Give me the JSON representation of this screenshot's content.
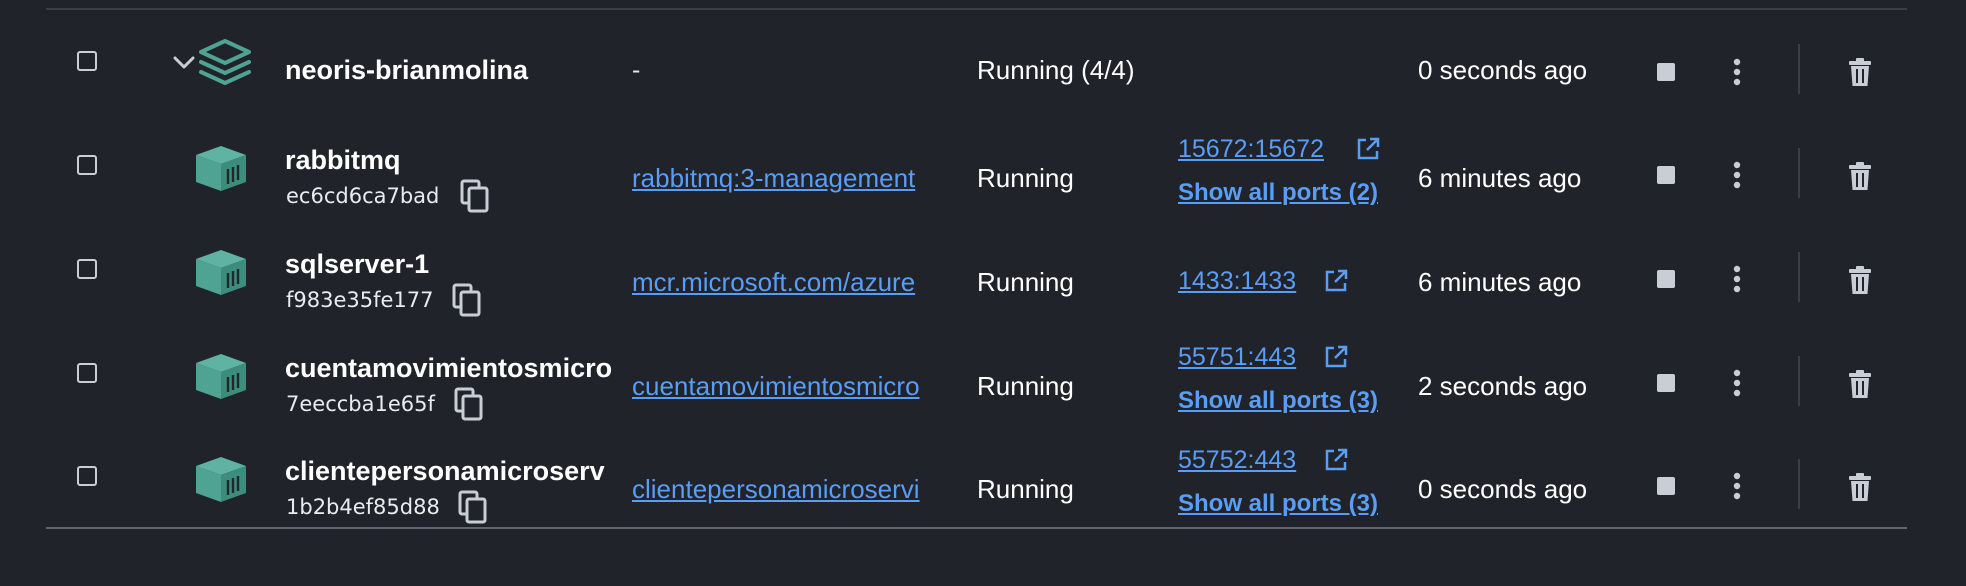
{
  "group": {
    "name": "neoris-brianmolina",
    "image": "-",
    "status": "Running (4/4)",
    "last_started": "0 seconds ago"
  },
  "containers": [
    {
      "name": "rabbitmq",
      "id": "ec6cd6ca7bad",
      "image": "rabbitmq:3-management",
      "status": "Running",
      "port": "15672:15672",
      "show_ports": "Show all ports (2)",
      "last_started": "6 minutes ago"
    },
    {
      "name": "sqlserver-1",
      "id": "f983e35fe177",
      "image": "mcr.microsoft.com/azure",
      "status": "Running",
      "port": "1433:1433",
      "show_ports": "",
      "last_started": "6 minutes ago"
    },
    {
      "name": "cuentamovimientosmicro",
      "id": "7eeccba1e65f",
      "image": "cuentamovimientosmicro",
      "status": "Running",
      "port": "55751:443",
      "show_ports": "Show all ports (3)",
      "last_started": "2 seconds ago"
    },
    {
      "name": "clientepersonamicroserv",
      "id": "1b2b4ef85d88",
      "image": "clientepersonamicroservi",
      "status": "Running",
      "port": "55752:443",
      "show_ports": "Show all ports (3)",
      "last_started": "0 seconds ago"
    }
  ],
  "colors": {
    "background": "#202329",
    "link": "#5a9df5",
    "icon_teal": "#4fa393",
    "text": "#ffffff"
  },
  "icons": {
    "group": "layers-stack-icon",
    "container": "container-cube-icon",
    "copy": "copy-icon",
    "external": "external-link-icon",
    "stop": "stop-icon",
    "menu": "kebab-menu-icon",
    "delete": "trash-icon",
    "expand": "chevron-down-icon"
  }
}
